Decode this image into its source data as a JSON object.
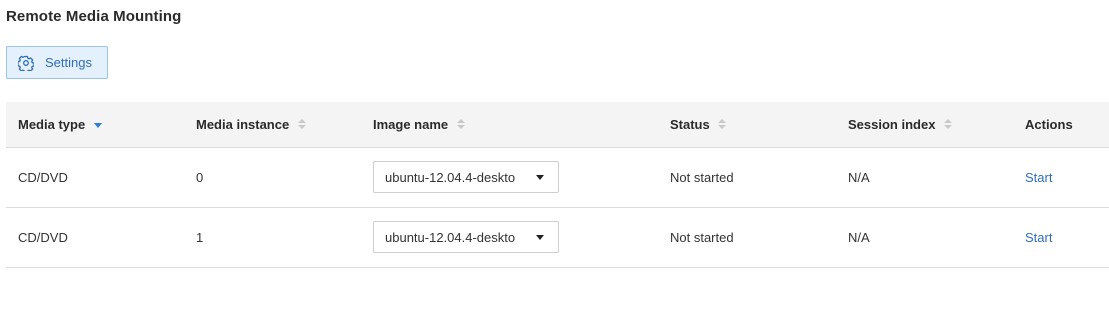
{
  "page": {
    "title": "Remote Media Mounting"
  },
  "toolbar": {
    "settings_label": "Settings",
    "settings_icon": "gear-icon"
  },
  "colors": {
    "accent": "#2f6fb8",
    "button_bg": "#e4f0fb",
    "button_border": "#9cc3ea",
    "header_bg": "#f4f4f4",
    "sort_active": "#2f7fd8"
  },
  "table": {
    "columns": [
      {
        "label": "Media type",
        "sort": "descending"
      },
      {
        "label": "Media instance",
        "sort": "none"
      },
      {
        "label": "Image name",
        "sort": "none"
      },
      {
        "label": "Status",
        "sort": "none"
      },
      {
        "label": "Session index",
        "sort": "none"
      },
      {
        "label": "Actions",
        "sort": "not-sortable"
      }
    ],
    "rows": [
      {
        "media_type": "CD/DVD",
        "media_instance": "0",
        "image_name": "ubuntu-12.04.4-deskto",
        "status": "Not started",
        "session_index": "N/A",
        "action": "Start"
      },
      {
        "media_type": "CD/DVD",
        "media_instance": "1",
        "image_name": "ubuntu-12.04.4-deskto",
        "status": "Not started",
        "session_index": "N/A",
        "action": "Start"
      }
    ]
  }
}
